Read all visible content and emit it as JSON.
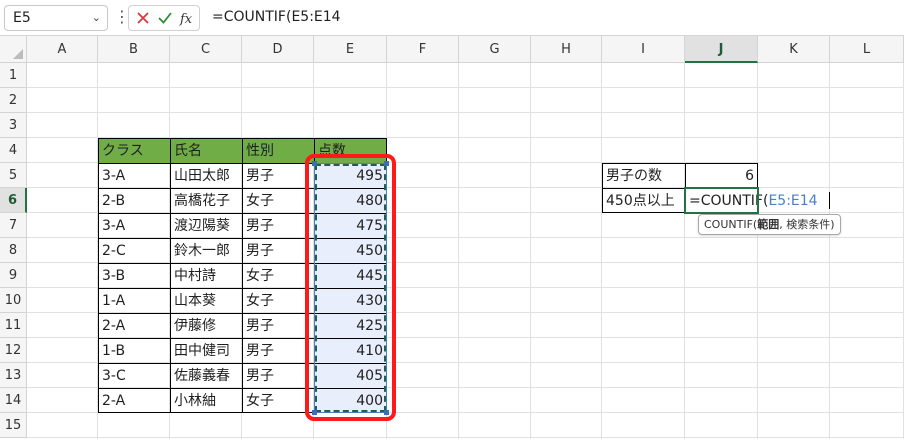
{
  "formula_bar": {
    "name_box": "E5",
    "formula": "=COUNTIF(E5:E14"
  },
  "columns": [
    "A",
    "B",
    "C",
    "D",
    "E",
    "F",
    "G",
    "H",
    "I",
    "J",
    "K",
    "L"
  ],
  "rows": [
    "1",
    "2",
    "3",
    "4",
    "5",
    "6",
    "7",
    "8",
    "9",
    "10",
    "11",
    "12",
    "13",
    "14",
    "15"
  ],
  "table": {
    "headers": [
      "クラス",
      "氏名",
      "性別",
      "点数"
    ],
    "rows": [
      [
        "3-A",
        "山田太郎",
        "男子",
        "495"
      ],
      [
        "2-B",
        "高橋花子",
        "女子",
        "480"
      ],
      [
        "3-A",
        "渡辺陽葵",
        "男子",
        "475"
      ],
      [
        "2-C",
        "鈴木一郎",
        "男子",
        "450"
      ],
      [
        "3-B",
        "中村詩",
        "女子",
        "445"
      ],
      [
        "1-A",
        "山本葵",
        "女子",
        "430"
      ],
      [
        "2-A",
        "伊藤修",
        "男子",
        "425"
      ],
      [
        "1-B",
        "田中健司",
        "男子",
        "410"
      ],
      [
        "3-C",
        "佐藤義春",
        "男子",
        "405"
      ],
      [
        "2-A",
        "小林紬",
        "女子",
        "400"
      ]
    ]
  },
  "summary": {
    "boys_label": "男子の数",
    "boys_value": "6",
    "over450_label": "450点以上",
    "edit_prefix": "=COUNTIF(",
    "edit_ref": "E5:E14"
  },
  "tooltip": {
    "func": "COUNTIF(",
    "arg1": "範囲",
    "rest": ", 検索条件)"
  },
  "colors": {
    "header_fill": "#70ad47",
    "range_fill": "#e8eefb",
    "highlight_border": "#ff1a1a",
    "ref_color": "#4a7fc1",
    "excel_green": "#217346"
  }
}
